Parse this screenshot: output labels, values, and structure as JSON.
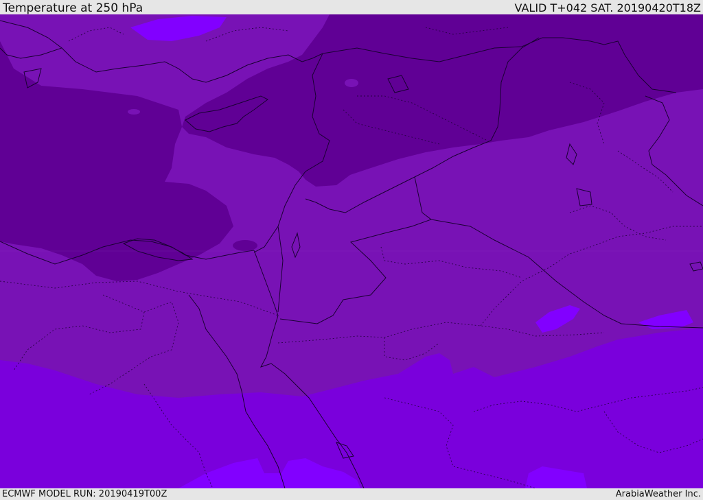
{
  "header": {
    "title": "Temperature at 250 hPa",
    "valid": "VALID T+042 SAT. 20190420T18Z"
  },
  "footer": {
    "model_run": "ECMWF MODEL RUN: 20190419T00Z",
    "credit": "ArabiaWeather Inc."
  },
  "colors": {
    "coldest_band": "#600095",
    "cold_band": "#7812b5",
    "mid_band": "#7a00dc",
    "warm_band": "#8200ff",
    "boundary_line": "#1a0033"
  }
}
